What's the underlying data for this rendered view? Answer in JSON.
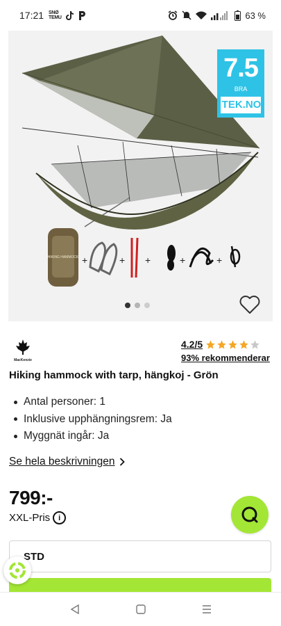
{
  "status_bar": {
    "time": "17:21",
    "small_app_label": "SNØ TEMU",
    "battery": "63 %",
    "icons": [
      "tiktok-icon",
      "parking-icon",
      "alarm-icon",
      "mute-icon",
      "wifi-icon",
      "signal-icon",
      "battery-icon"
    ]
  },
  "gallery": {
    "test_score": "7.5",
    "score_label": "BRA",
    "score_source": "TEK.NO",
    "package_label": "HIKING HAMMOCK",
    "page_count": 3,
    "active_index": 0,
    "colors": {
      "tarp": "#5b5f45",
      "badge": "#2ec3e6"
    }
  },
  "brand": {
    "name": "MacKenzie"
  },
  "rating": {
    "score": "4.2/5",
    "stars": 4.2,
    "max_stars": 5,
    "recommend_text": "93% rekommenderar"
  },
  "product": {
    "title": "Hiking hammock with tarp, hängkoj - Grön",
    "features": [
      "Antal personer: 1",
      "Inklusive upphängningsrem: Ja",
      "Myggnät ingår: Ja"
    ],
    "description_link": "Se hela beskrivningen"
  },
  "price": {
    "value": "799:-",
    "label": "XXL-Pris"
  },
  "variant": {
    "selected": "STD"
  },
  "colors": {
    "accent": "#a3e635",
    "text": "#111111",
    "star": "#f5a623",
    "star_empty": "#c8c8c8"
  }
}
